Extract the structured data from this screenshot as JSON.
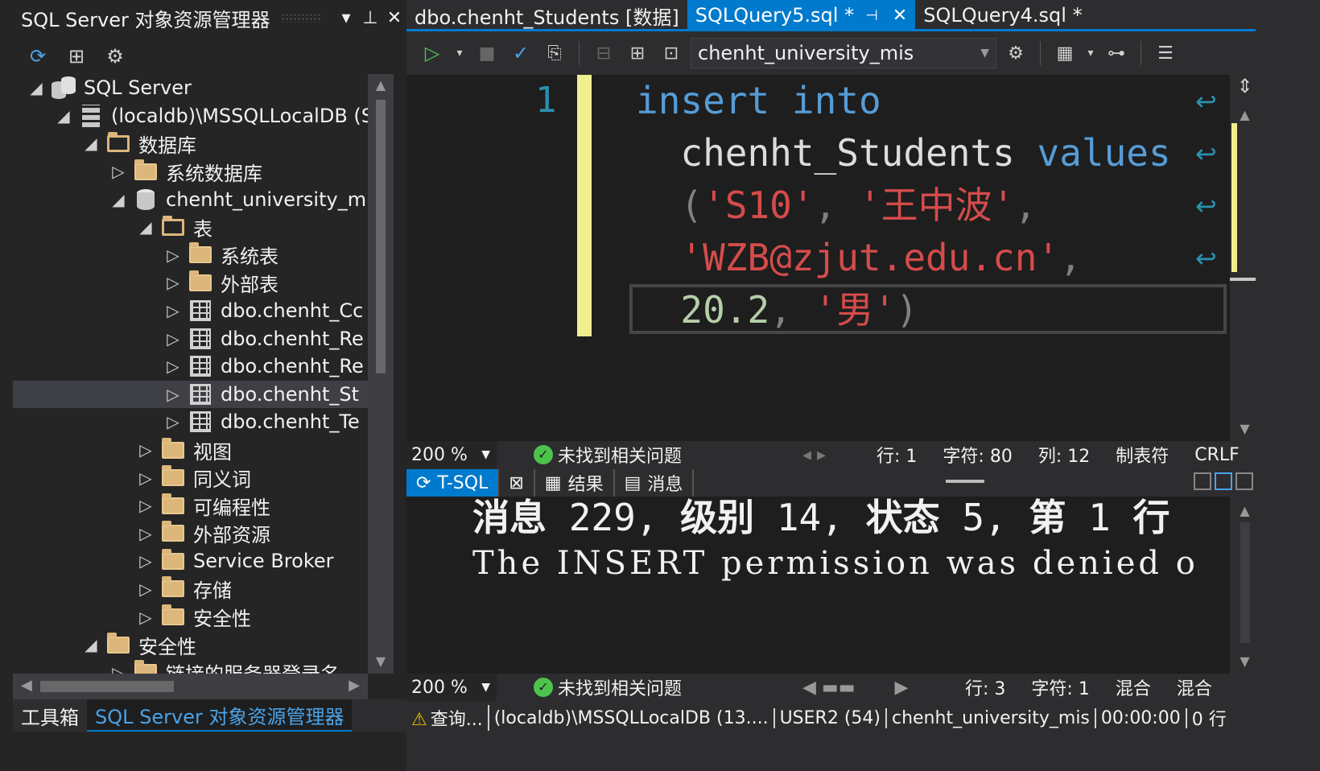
{
  "object_explorer": {
    "title": "SQL Server 对象资源管理器",
    "tree": [
      {
        "indent": 0,
        "expander": "◢",
        "icon": "sql",
        "label": "SQL Server"
      },
      {
        "indent": 1,
        "expander": "◢",
        "icon": "server",
        "label": "(localdb)\\MSSQLLocalDB (S"
      },
      {
        "indent": 2,
        "expander": "◢",
        "icon": "folder-open",
        "label": "数据库"
      },
      {
        "indent": 3,
        "expander": "▷",
        "icon": "folder",
        "label": "系统数据库"
      },
      {
        "indent": 3,
        "expander": "◢",
        "icon": "db",
        "label": "chenht_university_m"
      },
      {
        "indent": 4,
        "expander": "◢",
        "icon": "folder-open",
        "label": "表"
      },
      {
        "indent": 5,
        "expander": "▷",
        "icon": "folder",
        "label": "系统表"
      },
      {
        "indent": 5,
        "expander": "▷",
        "icon": "folder",
        "label": "外部表"
      },
      {
        "indent": 5,
        "expander": "▷",
        "icon": "table",
        "label": "dbo.chenht_Cc"
      },
      {
        "indent": 5,
        "expander": "▷",
        "icon": "table",
        "label": "dbo.chenht_Re"
      },
      {
        "indent": 5,
        "expander": "▷",
        "icon": "table",
        "label": "dbo.chenht_Re"
      },
      {
        "indent": 5,
        "expander": "▷",
        "icon": "table",
        "label": "dbo.chenht_St",
        "selected": true
      },
      {
        "indent": 5,
        "expander": "▷",
        "icon": "table",
        "label": "dbo.chenht_Te"
      },
      {
        "indent": 4,
        "expander": "▷",
        "icon": "folder",
        "label": "视图"
      },
      {
        "indent": 4,
        "expander": "▷",
        "icon": "folder",
        "label": "同义词"
      },
      {
        "indent": 4,
        "expander": "▷",
        "icon": "folder",
        "label": "可编程性"
      },
      {
        "indent": 4,
        "expander": "▷",
        "icon": "folder",
        "label": "外部资源"
      },
      {
        "indent": 4,
        "expander": "▷",
        "icon": "folder",
        "label": "Service Broker"
      },
      {
        "indent": 4,
        "expander": "▷",
        "icon": "folder",
        "label": "存储"
      },
      {
        "indent": 4,
        "expander": "▷",
        "icon": "folder",
        "label": "安全性"
      },
      {
        "indent": 2,
        "expander": "◢",
        "icon": "folder",
        "label": "安全性"
      },
      {
        "indent": 3,
        "expander": "▷",
        "icon": "folder",
        "label": "链接的服务器登录名"
      }
    ]
  },
  "bottom_tabs": {
    "toolbox": "工具箱",
    "explorer": "SQL Server 对象资源管理器"
  },
  "doc_tabs": {
    "tab1": "dbo.chenht_Students [数据]",
    "tab2": "SQLQuery5.sql *",
    "tab3": "SQLQuery4.sql *"
  },
  "query_toolbar": {
    "database": "chenht_university_mis"
  },
  "editor": {
    "line_number": "1",
    "code": {
      "insert": "insert",
      "into": "into",
      "table": "chenht_Students",
      "values": "values",
      "s_id": "'S10'",
      "s_name": "'王中波'",
      "s_email": "'WZB@zjut.edu.cn'",
      "n_val": "20.2",
      "s_sex": "'男'"
    }
  },
  "editor_status": {
    "zoom": "200 %",
    "issues": "未找到相关问题",
    "line": "行: 1",
    "char": "字符: 80",
    "col": "列: 12",
    "tabs": "制表符",
    "eol": "CRLF"
  },
  "results_tabs": {
    "tsql": "T-SQL",
    "results": "结果",
    "messages": "消息"
  },
  "messages": {
    "line1": {
      "a": "消息",
      "b": " 229, ",
      "c": "级别",
      "d": " 14, ",
      "e": "状态",
      "f": " 5, ",
      "g": "第",
      "h": " 1 ",
      "i": "行"
    },
    "line2": "The INSERT permission was denied o"
  },
  "results_status": {
    "zoom": "200 %",
    "issues": "未找到相关问题",
    "line": "行: 3",
    "char": "字符: 1",
    "mix1": "混合",
    "mix2": "混合"
  },
  "connection_bar": {
    "query": "查询...",
    "server": "(localdb)\\MSSQLLocalDB (13....",
    "user": "USER2 (54)",
    "database": "chenht_university_mis",
    "time": "00:00:00",
    "rows": "0 行"
  },
  "colors": {
    "accent": "#007acc",
    "keyword": "#569cd6",
    "string": "#d64b4b",
    "number": "#b5cea8",
    "changebar": "#efef91"
  }
}
